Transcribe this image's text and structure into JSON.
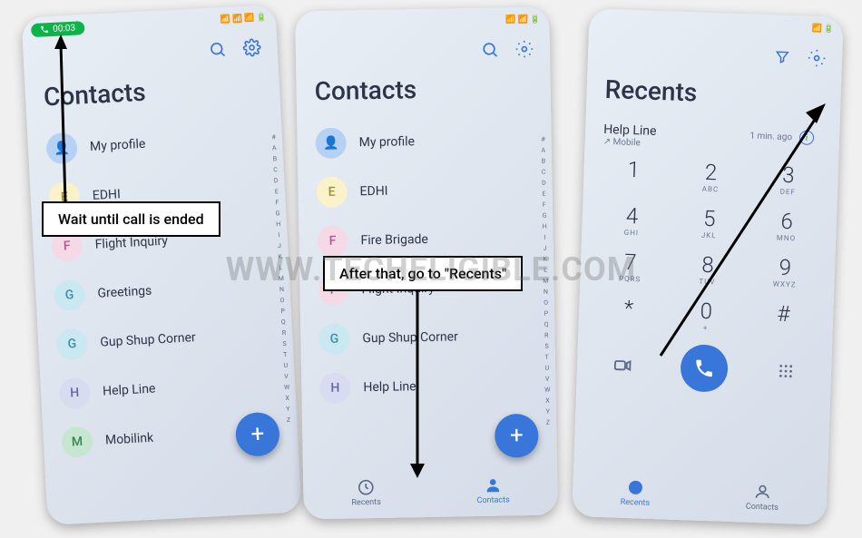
{
  "watermark": "WWW.TECHELIGIBLE.COM",
  "annotations": {
    "box1": "Wait until call is ended",
    "box2": "After that, go to \"Recents\""
  },
  "phone1": {
    "call_timer": "00:03",
    "status": "📶 📶 📶 🔋",
    "title": "Contacts",
    "contacts": [
      {
        "initial": "👤",
        "name": "My profile",
        "cls": "avatar-person"
      },
      {
        "initial": "E",
        "name": "EDHI",
        "cls": "avatar-e"
      },
      {
        "initial": "F",
        "name": "Flight Inquiry",
        "cls": "avatar-f"
      },
      {
        "initial": "G",
        "name": "Greetings",
        "cls": "avatar-g"
      },
      {
        "initial": "G",
        "name": "Gup Shup Corner",
        "cls": "avatar-g"
      },
      {
        "initial": "H",
        "name": "Help Line",
        "cls": "avatar-h"
      },
      {
        "initial": "M",
        "name": "Mobilink",
        "cls": "avatar-m"
      }
    ]
  },
  "phone2": {
    "title": "Contacts",
    "contacts": [
      {
        "initial": "👤",
        "name": "My profile",
        "cls": "avatar-person"
      },
      {
        "initial": "E",
        "name": "EDHI",
        "cls": "avatar-e"
      },
      {
        "initial": "F",
        "name": "Fire Brigade",
        "cls": "avatar-f"
      },
      {
        "initial": "F",
        "name": "Flight Inquiry",
        "cls": "avatar-f"
      },
      {
        "initial": "G",
        "name": "Gup Shup Corner",
        "cls": "avatar-g"
      },
      {
        "initial": "H",
        "name": "Help Line",
        "cls": "avatar-h"
      }
    ],
    "nav": {
      "recents": "Recents",
      "contacts": "Contacts"
    }
  },
  "phone3": {
    "title": "Recents",
    "recent": {
      "name": "Help Line",
      "sub": "↗ Mobile",
      "time": "1 min. ago"
    },
    "keys": [
      {
        "n": "1",
        "s": ""
      },
      {
        "n": "2",
        "s": "ABC"
      },
      {
        "n": "3",
        "s": "DEF"
      },
      {
        "n": "4",
        "s": "GHI"
      },
      {
        "n": "5",
        "s": "JKL"
      },
      {
        "n": "6",
        "s": "MNO"
      },
      {
        "n": "7",
        "s": "PQRS"
      },
      {
        "n": "8",
        "s": "TUV"
      },
      {
        "n": "9",
        "s": "WXYZ"
      },
      {
        "n": "*",
        "s": ""
      },
      {
        "n": "0",
        "s": "+"
      },
      {
        "n": "#",
        "s": ""
      }
    ],
    "nav": {
      "recents": "Recents",
      "contacts": "Contacts"
    }
  },
  "index_letters": "#\nA\nB\nC\nD\nE\nF\nG\nH\nI\nJ\nK\nL\nM\nN\nO\nP\nQ\nR\nS\nT\nU\nV\nW\nX\nY\nZ"
}
